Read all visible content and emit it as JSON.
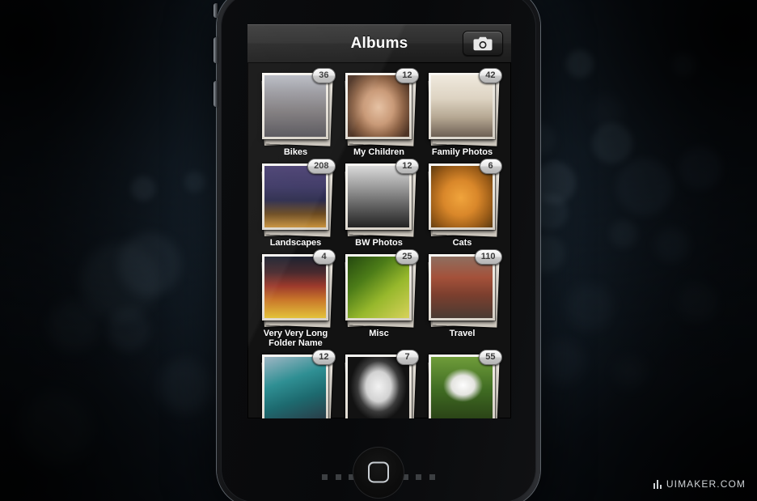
{
  "app": {
    "navbar": {
      "title": "Albums",
      "camera_button_label": "Camera",
      "camera_icon": "camera-icon"
    },
    "albums": [
      {
        "title": "Bikes",
        "count": "36",
        "photo": "cyclist-in-street"
      },
      {
        "title": "My Children",
        "count": "12",
        "photo": "young-girl-portrait"
      },
      {
        "title": "Family Photos",
        "count": "42",
        "photo": "family-on-porch"
      },
      {
        "title": "Landscapes",
        "count": "208",
        "photo": "golden-gate-bridge-night"
      },
      {
        "title": "BW Photos",
        "count": "12",
        "photo": "vintage-car-grille-bw"
      },
      {
        "title": "Cats",
        "count": "6",
        "photo": "orange-cat-hissing"
      },
      {
        "title": "Very Very Long\nFolder Name",
        "count": "4",
        "photo": "times-square-taxis"
      },
      {
        "title": "Misc",
        "count": "25",
        "photo": "wheat-stalks-green"
      },
      {
        "title": "Travel",
        "count": "110",
        "photo": "brick-archway-building"
      },
      {
        "title": "",
        "count": "12",
        "photo": "teal-scooter"
      },
      {
        "title": "",
        "count": "7",
        "photo": "woman-face-bw"
      },
      {
        "title": "",
        "count": "55",
        "photo": "white-rabbit-grass"
      }
    ]
  },
  "device": {
    "home_button_label": "Home",
    "page_dots": {
      "total": 9,
      "active_index": 3,
      "active_color": "#1ec8f0",
      "inactive_color": "#3c3f42"
    }
  },
  "watermark": {
    "text": "UIMAKER.COM"
  },
  "theme": {
    "screen_bg": "#121212",
    "navbar_top": "#3a3a3a",
    "navbar_bottom": "#1c1c1c",
    "badge_text": "#3a3a3a",
    "title_text": "#ffffff",
    "backdrop_blue": "#1b2b39"
  }
}
